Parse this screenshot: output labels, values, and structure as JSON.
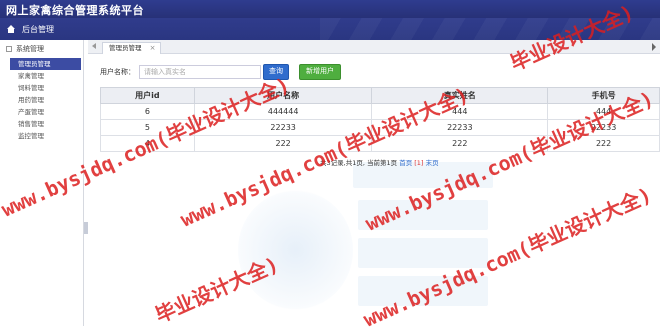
{
  "app": {
    "title": "网上家禽综合管理系统平台"
  },
  "nav": {
    "home_label": "后台管理"
  },
  "sidebar": {
    "section_label": "系统管理",
    "items": [
      {
        "label": "管理员管理",
        "active": true
      },
      {
        "label": "家禽管理"
      },
      {
        "label": "饲料管理"
      },
      {
        "label": "用药管理"
      },
      {
        "label": "产蛋管理"
      },
      {
        "label": "销售管理"
      },
      {
        "label": "监控管理"
      }
    ]
  },
  "tabs": [
    {
      "label": "管理员管理",
      "close": "×"
    }
  ],
  "search": {
    "label": "用户名称：",
    "placeholder": "请输入真实名",
    "query_button": "查询",
    "add_button": "新增用户"
  },
  "table": {
    "columns": [
      "用户id",
      "用户名称",
      "真实姓名",
      "手机号"
    ],
    "rows": [
      [
        "6",
        "444444",
        "444",
        "444"
      ],
      [
        "5",
        "22233",
        "22233",
        "22233"
      ],
      [
        "4",
        "222",
        "222",
        "222"
      ]
    ]
  },
  "pagination": {
    "summary": "共3记录,共1页, 当前第1页",
    "first": "首页",
    "page": "[1]",
    "last": "末页"
  },
  "watermark": {
    "text_url": "www.bysjdq.com(毕业设计大全)",
    "text_short": "毕业设计大全)"
  },
  "colors": {
    "header": "#2f3c8f",
    "active_item": "#3c4ca3",
    "query_button": "#2f6ccd",
    "add_button": "#4fae3f",
    "watermark": "#dc1e1e"
  }
}
